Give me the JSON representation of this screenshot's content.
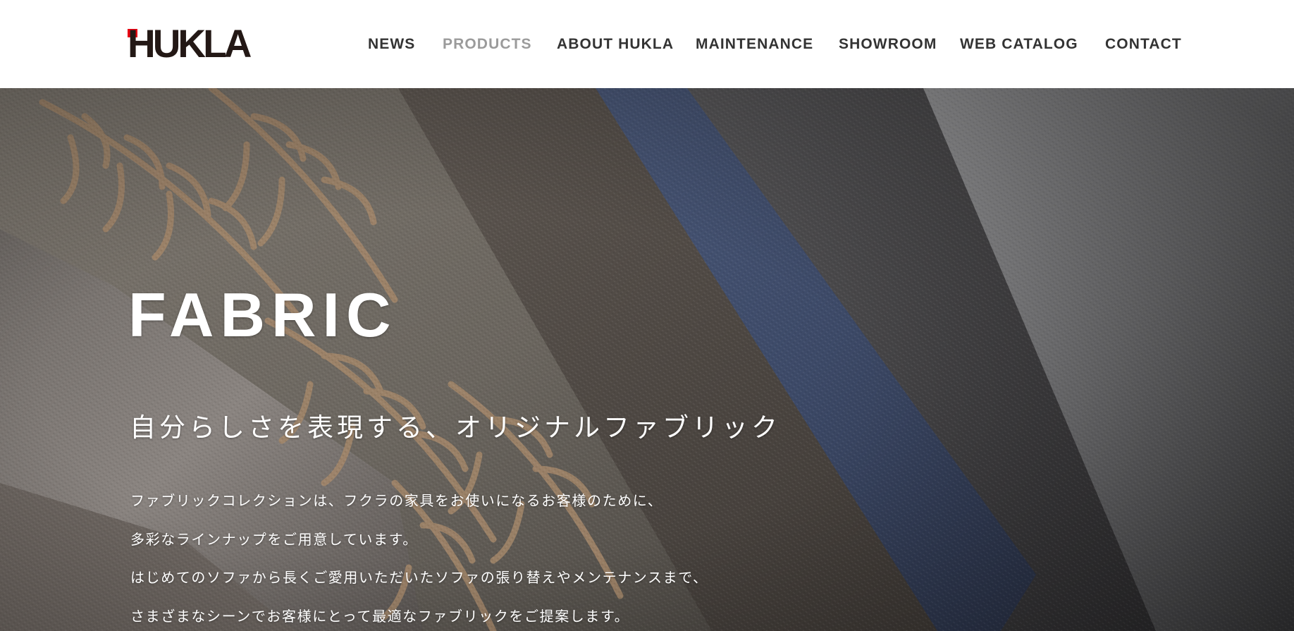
{
  "header": {
    "logo_text": "HUKLA",
    "nav": [
      {
        "label": "NEWS"
      },
      {
        "label": "PRODUCTS",
        "active": true
      },
      {
        "label": "ABOUT HUKLA"
      },
      {
        "label": "MAINTENANCE"
      },
      {
        "label": "SHOWROOM"
      },
      {
        "label": "WEB CATALOG"
      },
      {
        "label": "CONTACT"
      }
    ]
  },
  "hero": {
    "title": "FABRIC",
    "subtitle": "自分らしさを表現する、オリジナルファブリック",
    "body_lines": [
      "ファブリックコレクションは、フクラの家具をお使いになるお客様のために、",
      "多彩なラインナップをご用意しています。",
      "はじめてのソファから長くご愛用いただいたソファの張り替えやメンテナンスまで、",
      "さまざまなシーンでお客様にとって最適なファブリックをご提案します。"
    ]
  },
  "colors": {
    "brand_red": "#e60012",
    "logo_text": "#231815",
    "nav_text": "#333333",
    "nav_active": "#9b9b9b",
    "hero_text": "#ffffff"
  }
}
